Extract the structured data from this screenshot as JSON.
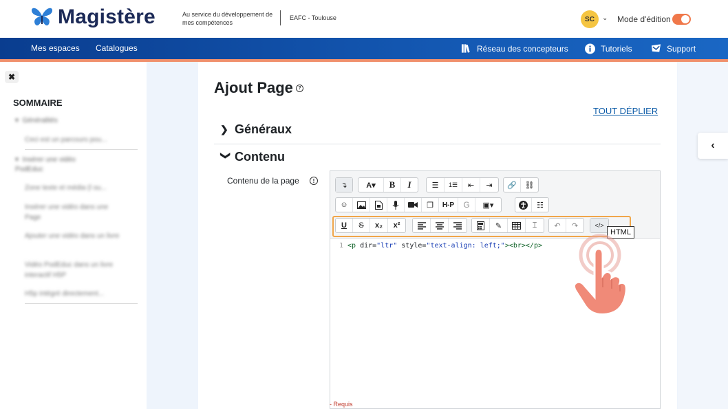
{
  "header": {
    "brand": "Magistère",
    "tagline": "Au service du développement de mes compétences",
    "organization": "EAFC - Toulouse",
    "user_initials": "SC",
    "edit_mode_label": "Mode d'édition",
    "edit_mode_on": true
  },
  "nav": {
    "left": [
      "Mes espaces",
      "Catalogues"
    ],
    "right": [
      {
        "label": "Réseau des concepteurs",
        "icon": "books-icon"
      },
      {
        "label": "Tutoriels",
        "icon": "info-icon"
      },
      {
        "label": "Support",
        "icon": "mail-icon"
      }
    ]
  },
  "drawer": {
    "title": "SOMMAIRE",
    "sections": [
      {
        "label": "Généralités",
        "items": [
          "Ceci est un parcours pou..."
        ]
      },
      {
        "label": "Insérer une vidéo PodEduc",
        "items": [
          "Zone texte et média (l ou...",
          "Insérer une vidéo dans une Page",
          "Ajouter une vidéo dans un livre",
          "Vidéo PodEduc dans un livre interactif H5P",
          "H5p intégré directement..."
        ]
      }
    ]
  },
  "main": {
    "title": "Ajout Page",
    "expand_all": "TOUT DÉPLIER",
    "sections": [
      "Généraux",
      "Contenu"
    ],
    "field_label": "Contenu de la page",
    "required": "- Requis"
  },
  "editor": {
    "row1": [
      "↴",
      "A▾",
      "B",
      "I",
      "☰",
      "1☰",
      "⇤",
      "⇥",
      "🔗",
      "⛓"
    ],
    "row3": [
      "U",
      "S",
      "x₂",
      "x²"
    ],
    "code_line_no": "1",
    "code_tag_open": "<p",
    "code_attr1": " dir=",
    "code_val1": "\"ltr\"",
    "code_attr2": " style=",
    "code_val2": "\"text-align: left;\"",
    "code_rest": "><br></p>",
    "tooltip": "HTML",
    "hp_label": "H-P",
    "g_label": "G"
  },
  "colors": {
    "brand_navy": "#1c2a57",
    "nav_blue": "#0a3d8f",
    "accent_orange": "#f0784a",
    "highlight": "#f0a64a",
    "link": "#0f5da8"
  }
}
